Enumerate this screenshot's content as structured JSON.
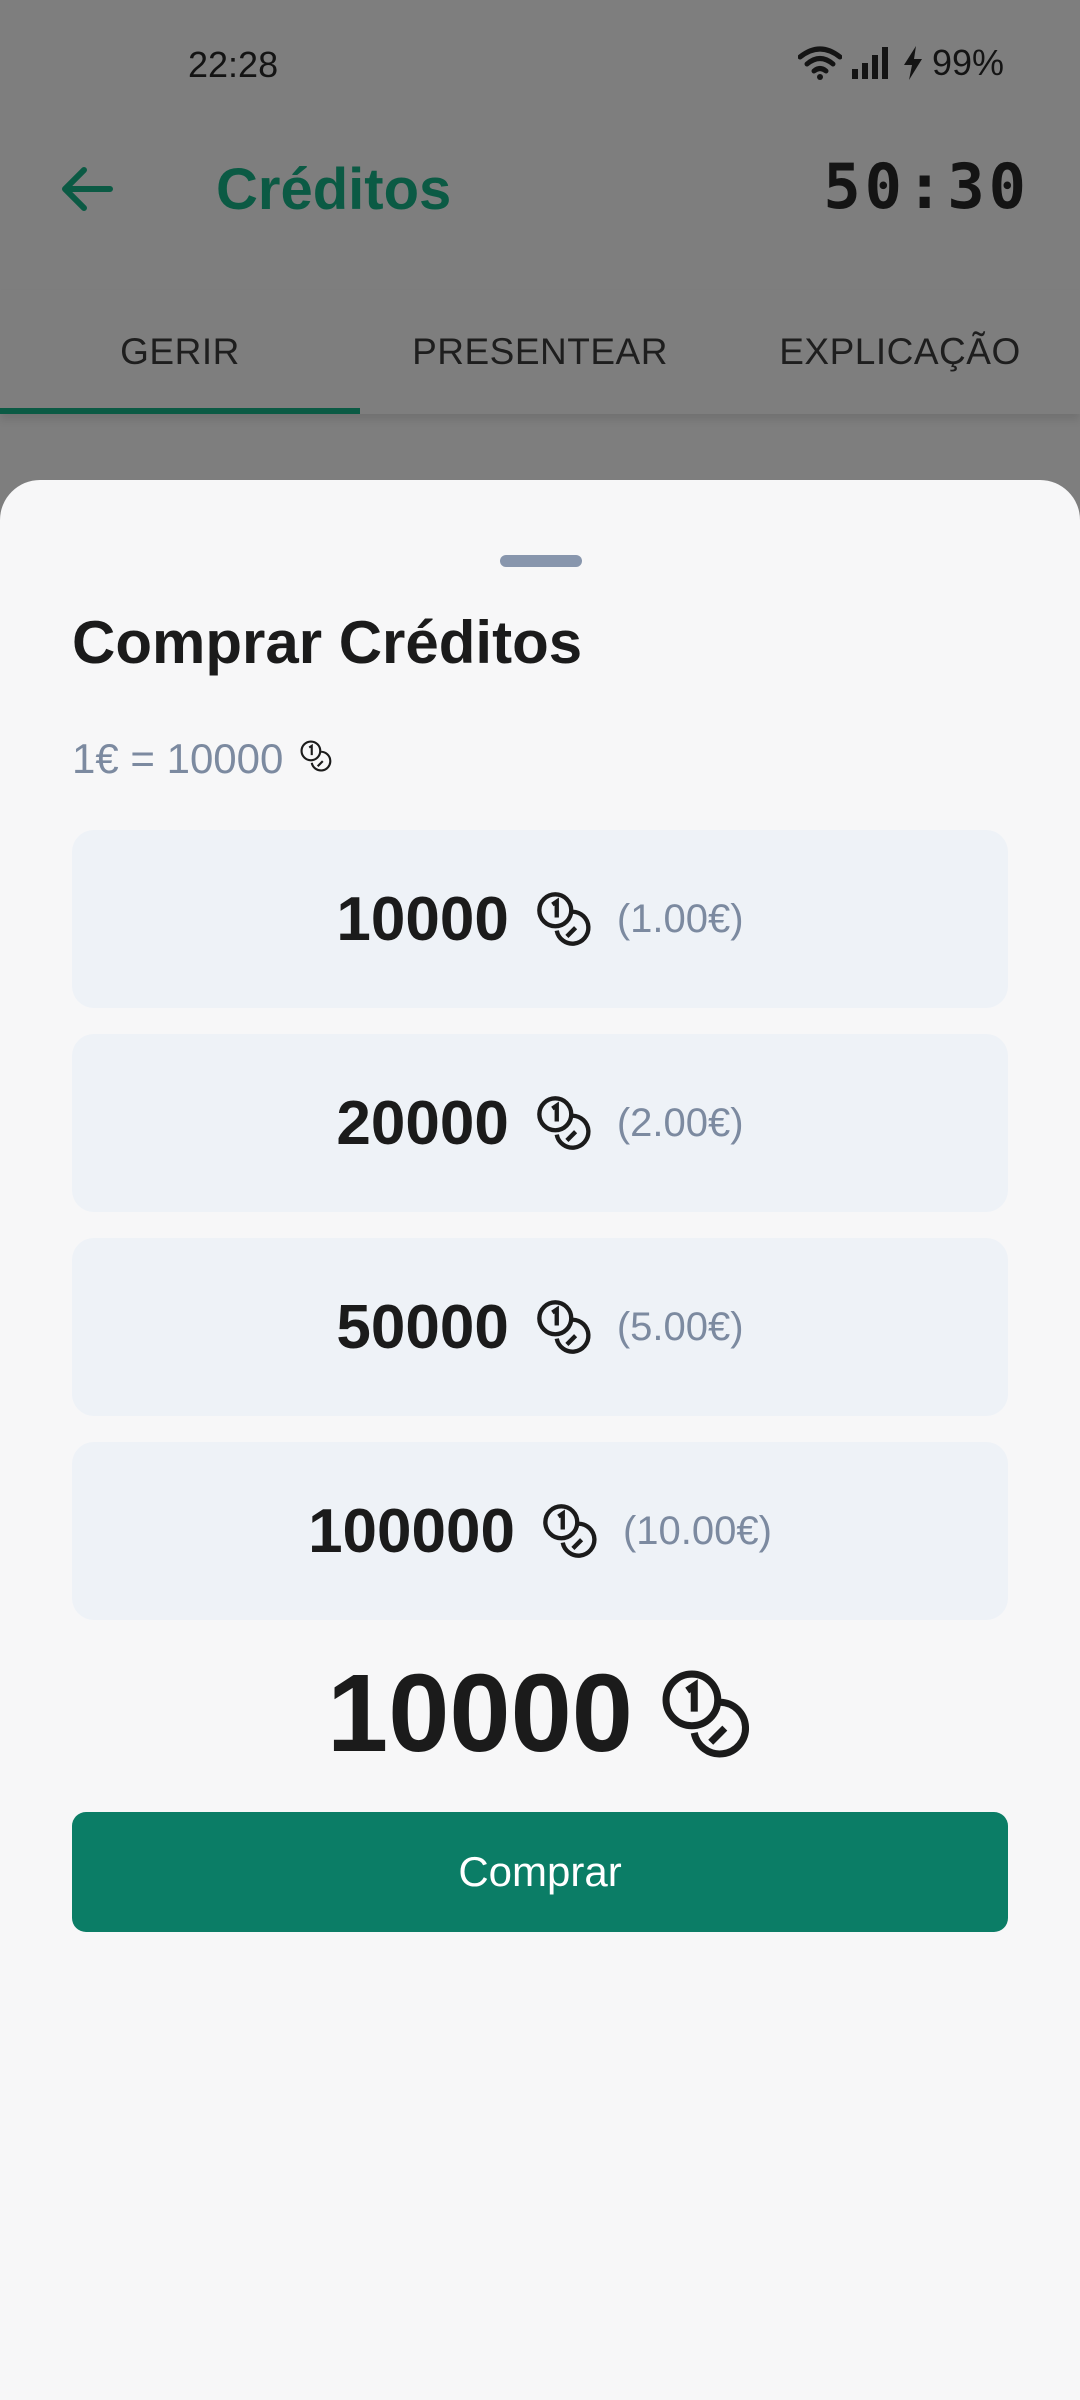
{
  "status_bar": {
    "time": "22:28",
    "battery": "99%"
  },
  "header": {
    "title": "Créditos",
    "timer": "50:30"
  },
  "tabs": [
    {
      "label": "GERIR",
      "active": true
    },
    {
      "label": "PRESENTEAR",
      "active": false
    },
    {
      "label": "EXPLICAÇÃO",
      "active": false
    }
  ],
  "sheet": {
    "title": "Comprar Créditos",
    "rate": "1€ = 10000",
    "options": [
      {
        "amount": "10000",
        "price": "(1.00€)"
      },
      {
        "amount": "20000",
        "price": "(2.00€)"
      },
      {
        "amount": "50000",
        "price": "(5.00€)"
      },
      {
        "amount": "100000",
        "price": "(10.00€)"
      }
    ],
    "selected_amount": "10000",
    "buy_label": "Comprar"
  },
  "colors": {
    "accent": "#0b7d66",
    "header_text": "#0b5a44",
    "muted": "#7c8aa0",
    "option_bg": "#eef2f7"
  },
  "icons": {
    "coin": "coins-icon",
    "back": "arrow-left-icon"
  }
}
